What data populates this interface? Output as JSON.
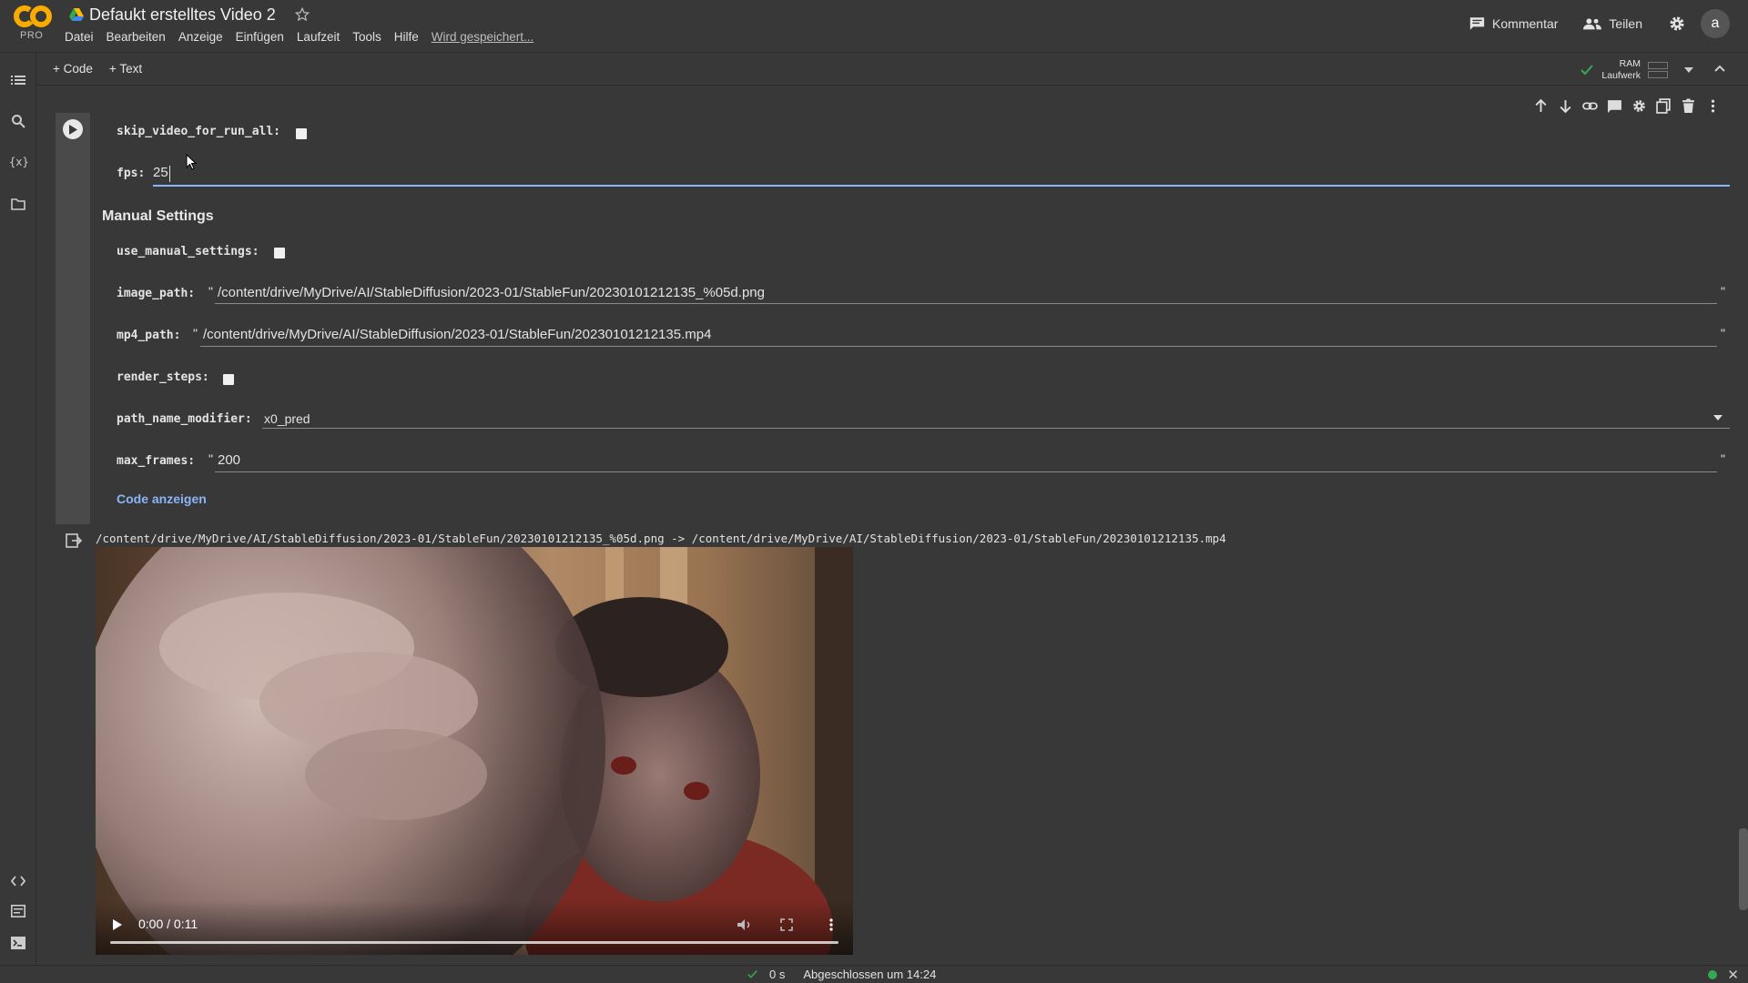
{
  "app": {
    "logo_text": "PRO",
    "doc_title": "Defaukt erstelltes Video 2"
  },
  "menu": [
    "Datei",
    "Bearbeiten",
    "Anzeige",
    "Einfügen",
    "Laufzeit",
    "Tools",
    "Hilfe"
  ],
  "saving_status": "Wird gespeichert...",
  "header_right": {
    "comment_label": "Kommentar",
    "share_label": "Teilen",
    "avatar_letter": "a"
  },
  "toolbar": {
    "add_code": "+ Code",
    "add_text": "+ Text",
    "ram_label": "RAM",
    "disk_label": "Laufwerk"
  },
  "form": {
    "skip_video_label": "skip_video_for_run_all:",
    "fps_label": "fps:",
    "fps_value": "25",
    "section_heading": "Manual Settings",
    "use_manual_label": "use_manual_settings:",
    "image_path_label": "image_path:",
    "image_path_value": "/content/drive/MyDrive/AI/StableDiffusion/2023-01/StableFun/20230101212135_%05d.png",
    "mp4_path_label": "mp4_path:",
    "mp4_path_value": "/content/drive/MyDrive/AI/StableDiffusion/2023-01/StableFun/20230101212135.mp4",
    "render_steps_label": "render_steps:",
    "path_modifier_label": "path_name_modifier:",
    "path_modifier_value": "x0_pred",
    "max_frames_label": "max_frames:",
    "max_frames_value": "200",
    "quote": "\"",
    "show_code": "Code anzeigen"
  },
  "output": {
    "text": "/content/drive/MyDrive/AI/StableDiffusion/2023-01/StableFun/20230101212135_%05d.png -> /content/drive/MyDrive/AI/StableDiffusion/2023-01/StableFun/20230101212135.mp4",
    "video_time": "0:00 / 0:11"
  },
  "status": {
    "duration": "0 s",
    "completed": "Abgeschlossen um 14:24",
    "close": "✕"
  },
  "colors": {
    "background": "#383838",
    "link": "#8ab4f8",
    "logo_orange": "#f9ab00",
    "status_green": "#34a853"
  }
}
